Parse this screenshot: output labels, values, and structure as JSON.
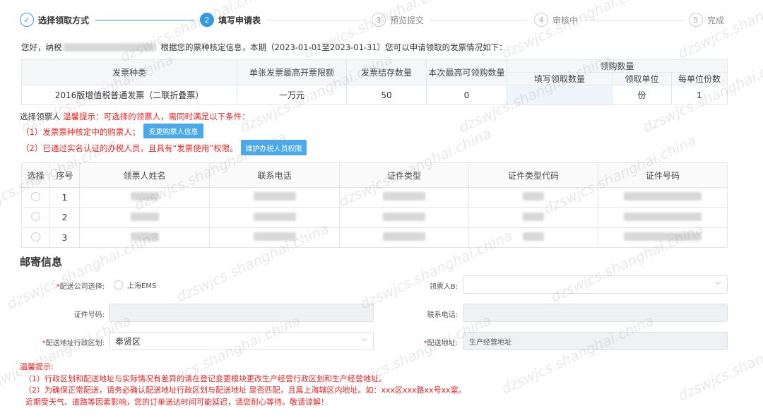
{
  "steps": [
    {
      "num": "✓",
      "label": "选择领取方式"
    },
    {
      "num": "2",
      "label": "填写申请表"
    },
    {
      "num": "3",
      "label": "预览提交"
    },
    {
      "num": "4",
      "label": "审核中"
    },
    {
      "num": "5",
      "label": "完成"
    }
  ],
  "intro": {
    "prefix": "您好，纳税",
    "suffix": "根据您的票种核定信息，本期（2023-01-01至2023-01-31）您可以申请领取的发票情况如下："
  },
  "invoice_table": {
    "headers": [
      "发票种类",
      "单张发票最高开票限额",
      "发票结存数量",
      "本次最高可领购数量",
      "领购数量",
      "填写领取数量",
      "领取单位",
      "每单位份数"
    ],
    "row": {
      "type": "2016版增值税普通发票（二联折叠票）",
      "limit": "一万元",
      "stock": "50",
      "max": "0",
      "qty": "",
      "unit": "份",
      "per_unit": "1"
    }
  },
  "selector": {
    "label": "选择领票人",
    "hint": "温馨提示：可选择的领票人，需同时满足以下条件：",
    "cond1": "（1）发票票种核定中的购票人；",
    "btn1": "变更购票人信息",
    "cond2": "（2）已通过实名认证的办税人员，且具有“发票使用”权限。",
    "btn2": "维护办税人员权限"
  },
  "person_table": {
    "headers": [
      "选择",
      "序号",
      "领票人姓名",
      "联系电话",
      "证件类型",
      "证件类型代码",
      "证件号码"
    ],
    "rows": [
      "1",
      "2",
      "3"
    ]
  },
  "mail": {
    "title": "邮寄信息",
    "company_label": "配送公司选择:",
    "company_option": "上海EMS",
    "recipient_label": "领票人B:",
    "recipient_value": "",
    "id_label": "证件号码:",
    "id_value": "",
    "phone_label": "联系电话:",
    "phone_value": "",
    "district_label": "配送地址行政区划:",
    "district_value": "奉贤区",
    "address_label": "配送地址:",
    "address_value": "生产经营地址"
  },
  "notice": {
    "title": "温馨提示:",
    "lines": [
      "（1）行政区划和配送地址与实际情况有差异的请在登记变更模块更改生产经营行政区划和生产经营地址。",
      "（2）为确保正常配送，请务必确认配送地址行政区划与配送地址 是否匹配，且属上海辖区内地址。如：xxx区xxx路xx号xx室。",
      "近期受天气、道路等因素影响，您的订单送达时间可能延迟，请您耐心等待。敬请谅解！"
    ]
  },
  "watermark": "dzswjcs.shanghai.china"
}
